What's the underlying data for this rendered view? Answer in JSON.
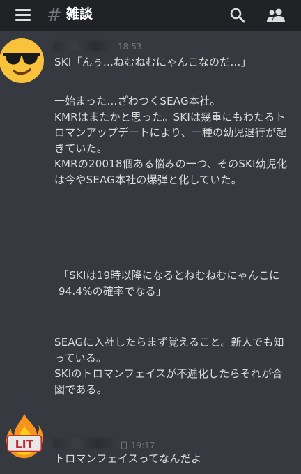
{
  "header": {
    "channel_hash": "#",
    "channel_name": "雑談",
    "icons": [
      "menu-icon",
      "search-icon",
      "members-icon"
    ]
  },
  "messages": [
    {
      "avatar": "sunglasses-emoji-avatar",
      "timestamp": "18:53",
      "paragraphs": [
        "SKI「んぅ…ねむねむにゃんこなのだ…」",
        "一始まった…ざわつくSEAG本社。\nKMRはまたかと思った。SKIは幾重にもわたるトロマンアップデートにより、一種の幼児退行が起きていた。\nKMRの20018個ある悩みの一つ、そのSKI幼児化は今やSEAG本社の爆弾と化していた。",
        "「SKIは19時以降になるとねむねむにゃんこに94.4%の確率でなる」",
        "SEAGに入社したらまず覚えること。新人でも知っている。\nSKIのトロマンフェイスが不逓化したらそれが合図である。"
      ]
    },
    {
      "avatar": "lit-fire-avatar",
      "avatar_text": "LIT",
      "timestamp": "日 19:17",
      "paragraphs": [
        "トロマンフェイスってなんだよ"
      ]
    }
  ],
  "colors": {
    "background": "#36393f",
    "header": "#202225",
    "text": "#dcddde",
    "timestamp": "#72767d"
  }
}
